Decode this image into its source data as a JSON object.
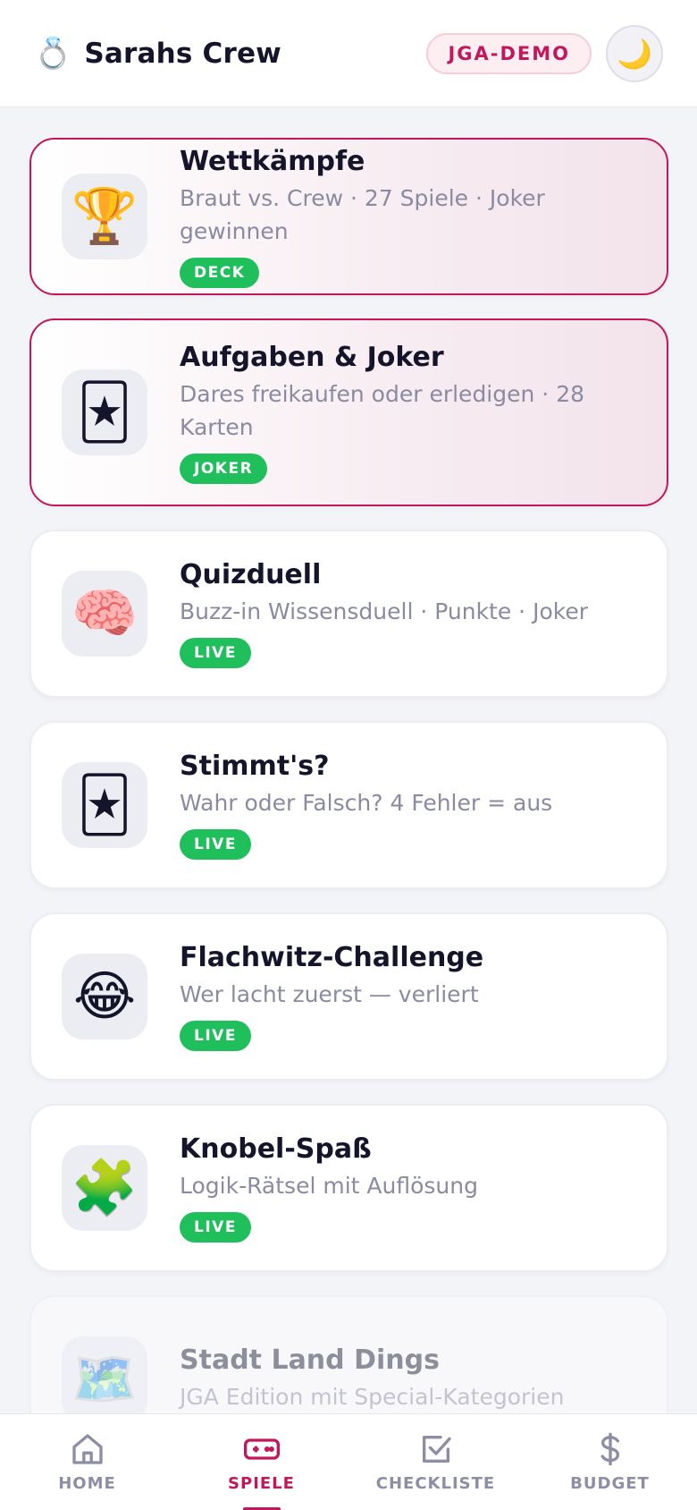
{
  "header": {
    "icon": "ring-icon",
    "icon_glyph": "💍",
    "title": "Sarahs Crew",
    "badge": "JGA-DEMO",
    "theme_icon": "moon-icon",
    "theme_glyph": "🌙"
  },
  "games": [
    {
      "icon": "trophy-icon",
      "glyph": "🏆",
      "title": "Wettkämpfe",
      "desc": "Braut vs. Crew · 27 Spiele · Joker gewinnen",
      "tag": "DECK",
      "featured": true
    },
    {
      "icon": "joker-card-icon",
      "glyph": "🃏",
      "title": "Aufgaben & Joker",
      "desc": "Dares freikaufen oder erledigen · 28 Karten",
      "tag": "JOKER",
      "featured": true
    },
    {
      "icon": "brain-icon",
      "glyph": "🧠",
      "title": "Quizduell",
      "desc": "Buzz-in Wissensduell · Punkte · Joker",
      "tag": "LIVE",
      "featured": false
    },
    {
      "icon": "joker-card-icon",
      "glyph": "🃏",
      "title": "Stimmt's?",
      "desc": "Wahr oder Falsch? 4 Fehler = aus",
      "tag": "LIVE",
      "featured": false
    },
    {
      "icon": "laughing-face-icon",
      "glyph": "😂",
      "title": "Flachwitz-Challenge",
      "desc": "Wer lacht zuerst — verliert",
      "tag": "LIVE",
      "featured": false
    },
    {
      "icon": "puzzle-piece-icon",
      "glyph": "🧩",
      "title": "Knobel-Spaß",
      "desc": "Logik-Rätsel mit Auflösung",
      "tag": "LIVE",
      "featured": false
    },
    {
      "icon": "map-icon",
      "glyph": "🗺️",
      "title": "Stadt Land Dings",
      "desc": "JGA Edition mit Special-Kategorien",
      "tag": "",
      "featured": false
    }
  ],
  "nav": [
    {
      "label": "HOME",
      "icon": "home-icon",
      "active": false
    },
    {
      "label": "SPIELE",
      "icon": "gamepad-icon",
      "active": true
    },
    {
      "label": "CHECKLISTE",
      "icon": "checkbox-icon",
      "active": false
    },
    {
      "label": "BUDGET",
      "icon": "dollar-icon",
      "active": false
    }
  ],
  "colors": {
    "accent": "#c2185b",
    "live_tag": "#1fbf5c",
    "muted_text": "#8a8aa3"
  }
}
